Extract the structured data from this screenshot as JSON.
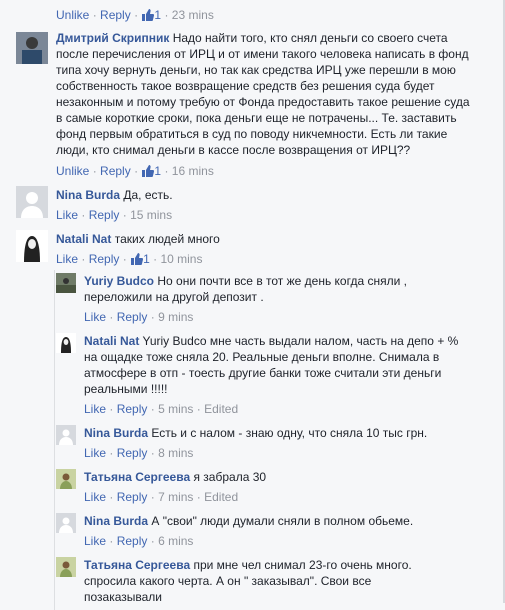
{
  "actions": {
    "unlike": "Unlike",
    "like": "Like",
    "reply": "Reply",
    "dot": "·",
    "edited": "Edited"
  },
  "comments": [
    {
      "meta": "23 mins",
      "likes": "1",
      "liked": true
    },
    {
      "author": "Дмитрий Скрипник",
      "text": "Надо найти того, кто снял деньги со своего счета после перечисления от ИРЦ и от имени такого человека написать в фонд типа хочу вернуть деньги, но так как средства ИРЦ уже перешли в мою собственность такое возвращение средств без решения суда будет незаконным и потому требую от Фонда предоставить такое решение суда в самые короткие сроки, пока деньги еще не потрачены... Те. заставить фонд первым обратиться в суд по поводу никчемности. Есть ли такие люди, кто снимал деньги в кассе после возвращения от ИРЦ??",
      "likes": "1",
      "meta": "16 mins",
      "liked": true
    },
    {
      "author": "Nina Burda",
      "text": "Да, есть.",
      "meta": "15 mins"
    },
    {
      "author": "Natali Nat",
      "text": "таких людей много",
      "likes": "1",
      "meta": "10 mins"
    },
    {
      "author": "Yuriy Budco",
      "text": "Но они почти все в тот же день когда сняли , переложили на другой депозит .",
      "meta": "9 mins"
    },
    {
      "author": "Natali Nat",
      "text": "Yuriy Budco мне часть выдали налом, часть на депо + % на ощадке тоже сняла 20. Реальные деньги вполне. Снимала в атмосфере в отп - тоесть другие банки тоже считали эти деньги реальными !!!!!",
      "meta": "5 mins"
    },
    {
      "author": "Nina Burda",
      "text": "Есть и с налом - знаю одну, что сняла 10 тыс грн.",
      "meta": "8 mins"
    },
    {
      "author": "Татьяна Сергеева",
      "text": "я забрала 30",
      "meta": "7 mins"
    },
    {
      "author": "Nina Burda",
      "text": "А \"свои\" люди думали сняли в полном обьеме.",
      "meta": "6 mins"
    },
    {
      "author": "Татьяна Сергеева",
      "text": "при мне чел снимал 23-го очень много. спросила какого черта. А он \" заказывал\". Свои все позаказывали"
    }
  ]
}
